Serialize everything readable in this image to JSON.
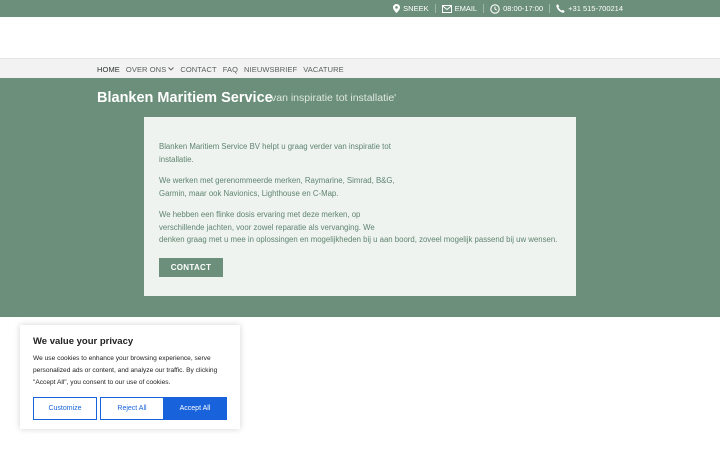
{
  "topbar": {
    "location": "SNEEK",
    "email": "EMAIL",
    "hours": "08:00-17:00",
    "phone": "+31 515-700214"
  },
  "nav": {
    "items": [
      "HOME",
      "OVER ONS",
      "CONTACT",
      "FAQ",
      "NIEUWSBRIEF",
      "VACATURE"
    ]
  },
  "hero": {
    "site_title": "Blanken Maritiem Service",
    "tagline": "'van inspiratie tot installatie'"
  },
  "content": {
    "p1": "Blanken Maritiem Service BV helpt u graag verder van inspiratie tot installatie.",
    "p2": "We werken met gerenommeerde merken, Raymarine, Simrad, B&G, Garmin, maar ook Navionics, Lighthouse en C-Map.",
    "p3_line1": "We hebben een flinke dosis ervaring met deze merken, op",
    "p3_line2": "verschillende jachten, voor zowel reparatie als vervanging. We",
    "p3_line3": "denken graag met u mee in oplossingen en mogelijkheden bij u aan boord, zoveel mogelijk passend bij uw wensen.",
    "contact_button": "CONTACT"
  },
  "cookie": {
    "title": "We value your privacy",
    "text": "We use cookies to enhance your browsing experience, serve personalized ads or content, and analyze our traffic. By clicking \"Accept All\", you consent to our use of cookies.",
    "customize": "Customize",
    "reject": "Reject All",
    "accept": "Accept All"
  },
  "colors": {
    "brand_green": "#6b8f7a",
    "card_bg": "#eef3ef",
    "cookie_blue": "#1863dc"
  },
  "icons": [
    "map-pin-icon",
    "envelope-icon",
    "clock-icon",
    "phone-icon",
    "chevron-down-icon"
  ]
}
